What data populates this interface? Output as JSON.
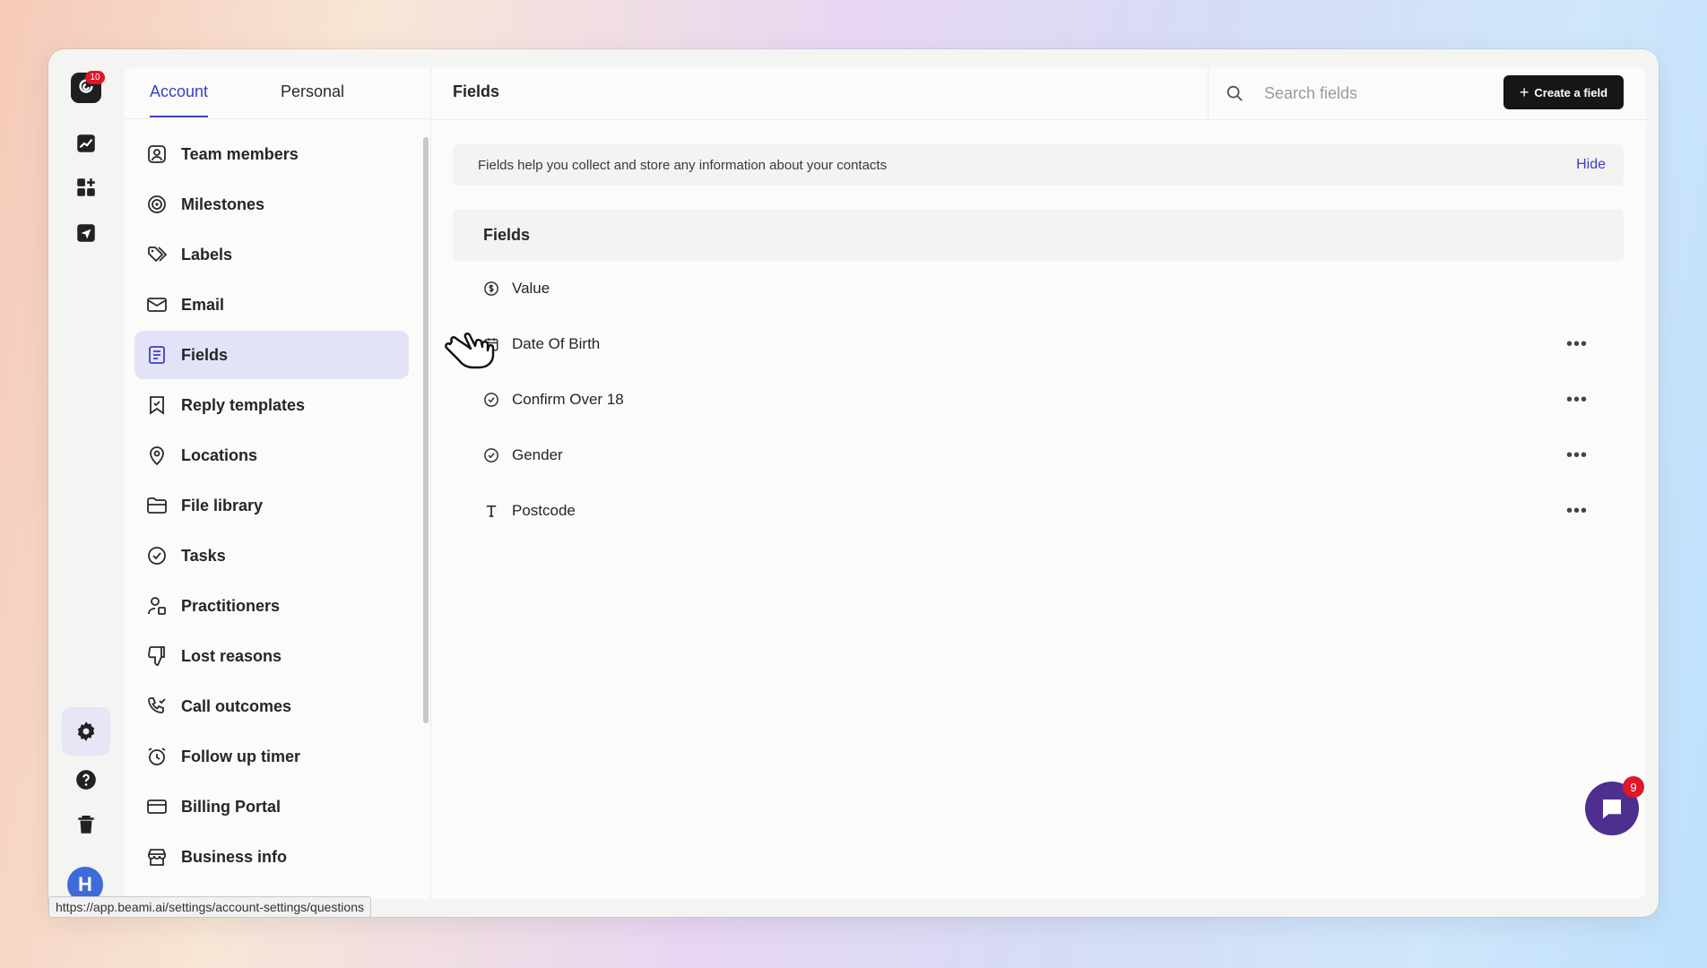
{
  "rail": {
    "logo_badge": "10",
    "avatar_initial": "H",
    "items": [
      {
        "icon": "chart-icon"
      },
      {
        "icon": "apps-icon"
      },
      {
        "icon": "send-icon"
      },
      {
        "icon": "gear-icon"
      },
      {
        "icon": "help-icon"
      },
      {
        "icon": "trash-icon"
      }
    ]
  },
  "settings": {
    "tabs": [
      {
        "label": "Account"
      },
      {
        "label": "Personal"
      }
    ],
    "menu": [
      {
        "label": "Team members",
        "icon": "user-square-icon"
      },
      {
        "label": "Milestones",
        "icon": "target-icon"
      },
      {
        "label": "Labels",
        "icon": "tag-icon"
      },
      {
        "label": "Email",
        "icon": "mail-icon"
      },
      {
        "label": "Fields",
        "icon": "form-icon"
      },
      {
        "label": "Reply templates",
        "icon": "bookmark-icon"
      },
      {
        "label": "Locations",
        "icon": "pin-icon"
      },
      {
        "label": "File library",
        "icon": "folder-icon"
      },
      {
        "label": "Tasks",
        "icon": "check-circle-icon"
      },
      {
        "label": "Practitioners",
        "icon": "user-icon"
      },
      {
        "label": "Lost reasons",
        "icon": "thumbs-down-icon"
      },
      {
        "label": "Call outcomes",
        "icon": "phone-check-icon"
      },
      {
        "label": "Follow up timer",
        "icon": "alarm-icon"
      },
      {
        "label": "Billing Portal",
        "icon": "card-icon"
      },
      {
        "label": "Business info",
        "icon": "store-icon"
      }
    ]
  },
  "main": {
    "title": "Fields",
    "search_placeholder": "Search fields",
    "create_label": "Create a field",
    "info_text": "Fields help you collect and store any information about your contacts",
    "hide_label": "Hide",
    "section_title": "Fields",
    "fields": [
      {
        "name": "Value",
        "icon": "dollar-icon",
        "has_menu": false
      },
      {
        "name": "Date Of Birth",
        "icon": "calendar-icon",
        "has_menu": true
      },
      {
        "name": "Confirm Over 18",
        "icon": "check-circle-icon",
        "has_menu": true
      },
      {
        "name": "Gender",
        "icon": "check-circle-icon",
        "has_menu": true
      },
      {
        "name": "Postcode",
        "icon": "text-icon",
        "has_menu": true
      }
    ],
    "more_glyph": "•••"
  },
  "status_url": "https://app.beami.ai/settings/account-settings/questions",
  "chat_badge": "9",
  "colors": {
    "accent": "#3d3fc4",
    "active_bg": "#e3e3f8",
    "badge": "#e0162b",
    "chat": "#4e2e8f"
  }
}
